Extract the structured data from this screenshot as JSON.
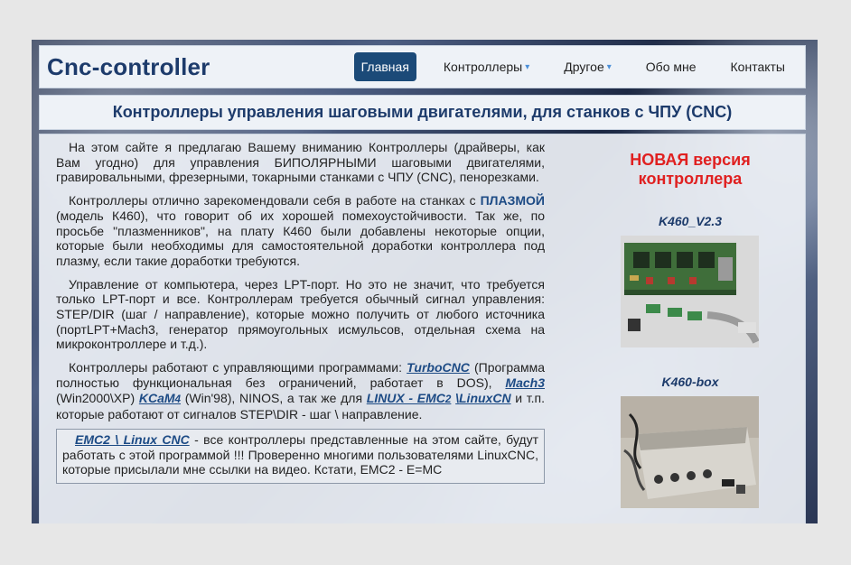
{
  "site": {
    "logo": "Cnc-controller"
  },
  "nav": {
    "items": [
      {
        "label": "Главная",
        "active": true,
        "dropdown": false
      },
      {
        "label": "Контроллеры",
        "active": false,
        "dropdown": true
      },
      {
        "label": "Другое",
        "active": false,
        "dropdown": true
      },
      {
        "label": "Обо мне",
        "active": false,
        "dropdown": false
      },
      {
        "label": "Контакты",
        "active": false,
        "dropdown": false
      }
    ],
    "caret": "▾"
  },
  "page": {
    "title": "Контроллеры управления шаговыми двигателями, для станков с ЧПУ (CNC)"
  },
  "main": {
    "p1": "На этом сайте я предлагаю Вашему вниманию Контроллеры (драйверы, как Вам угодно) для управления БИПОЛЯРНЫМИ шаговыми двигателями, гравировальными, фрезерными, токарными станками с ЧПУ (CNC), пенорезками.",
    "p2_before": "Контроллеры отлично зарекомендовали себя в работе на станках с ",
    "p2_link": "ПЛАЗМОЙ",
    "p2_after": " (модель К460), что говорит об их хорошей помехоустойчивости. Так же, по просьбе \"плазменников\", на плату К460 были добавлены некоторые опции, которые были необходимы для самостоятельной доработки контроллера под плазму, если такие доработки требуются.",
    "p3": "Управление от компьютера, через LPT-порт. Но это не значит, что требуется только LPT-порт и все. Контроллерам требуется обычный сигнал управления: STEP/DIR (шаг / направление), которые можно получить от любого источника (портLPT+Mach3, генератор прямоугольных исмульсов, отдельная схема на микроконтроллере и т.д.).",
    "p4_a": "Контроллеры работают с управляющими программами: ",
    "p4_link1": "TurboCNC",
    "p4_b": " (Программа полностью функциональная без ограничений, работает в DOS), ",
    "p4_link2": "Mach3",
    "p4_c": " (Win2000\\XP) ",
    "p4_link3": "KCaM",
    "p4_link3_sub": "4",
    "p4_d": " (Win'98), NINOS, а так же для ",
    "p4_link4": "LINUX - EMC",
    "p4_link4_sub": "2",
    "p4_link5": "\\LinuxCN",
    "p4_e": " и т.п. которые работают от сигналов STEP\\DIR - шаг \\ направление.",
    "box_link": "EMC2 \\ Linux CNC",
    "box_text": " - все контроллеры представленные на этом сайте, будут работать с этой программой !!! Проверенно многими пользователями LinuxCNC, которые присылали мне ссылки на видео. Кстати, EMC2 - E=MC"
  },
  "sidebar": {
    "new_title": "НОВАЯ версия контроллера",
    "products": [
      {
        "label": "K460_V2.3"
      },
      {
        "label": "K460-box"
      }
    ]
  },
  "colors": {
    "brand": "#1d3b6b",
    "nav_active": "#1b4a78",
    "accent_red": "#e02020",
    "link": "#1d4b85"
  }
}
